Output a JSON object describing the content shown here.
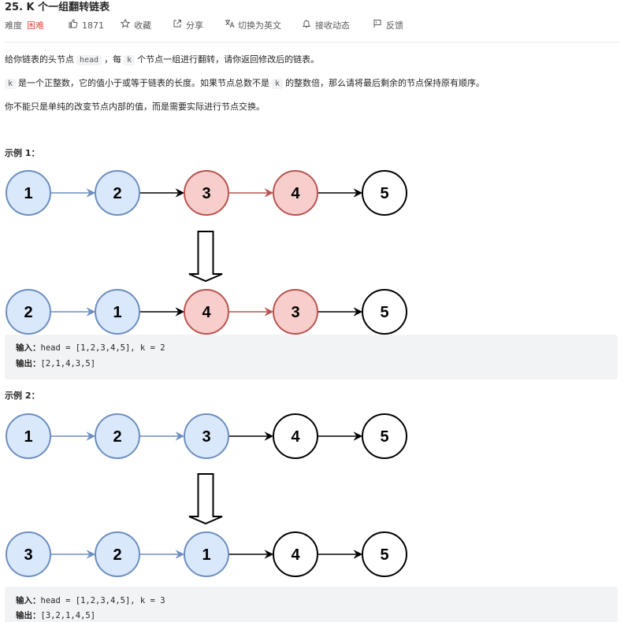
{
  "problem": {
    "title": "25. K 个一组翻转链表"
  },
  "meta": {
    "difficulty_label": "难度",
    "difficulty_value": "困难",
    "likes": "1871",
    "favorite_label": "收藏",
    "share_label": "分享",
    "switch_lang_label": "切换为英文",
    "notify_label": "接收动态",
    "feedback_label": "反馈",
    "icons": [
      "thumbs-up-icon",
      "star-icon",
      "share-icon",
      "translate-icon",
      "bell-icon",
      "feedback-icon"
    ],
    "hard_color": "#ef4743"
  },
  "description": {
    "p1_a": "给你链表的头节点",
    "p1_code": "head",
    "p1_b": "，每",
    "p1_k": "k",
    "p1_c": "个节点一组进行翻转，请你返回修改后的链表。",
    "p2_k": "k",
    "p2_a": "是一个正整数，它的值小于或等于链表的长度。如果节点总数不是",
    "p2_k2": "k",
    "p2_b": "的整数倍，那么请将最后剩余的节点保持原有顺序。",
    "p3": "你不能只是单纯的改变节点内部的值，而是需要实际进行节点交换。"
  },
  "examples": [
    {
      "title": "示例 1：",
      "before": [
        "1",
        "2",
        "3",
        "4",
        "5"
      ],
      "after": [
        "2",
        "1",
        "4",
        "3",
        "5"
      ],
      "before_groups": [
        "blue",
        "blue",
        "red",
        "red",
        "plain"
      ],
      "after_groups": [
        "blue",
        "blue",
        "red",
        "red",
        "plain"
      ],
      "input_label": "输入：",
      "input_value": "head = [1,2,3,4,5], k = 2",
      "output_label": "输出：",
      "output_value": "[2,1,4,3,5]"
    },
    {
      "title": "示例 2：",
      "before": [
        "1",
        "2",
        "3",
        "4",
        "5"
      ],
      "after": [
        "3",
        "2",
        "1",
        "4",
        "5"
      ],
      "before_groups": [
        "blue",
        "blue",
        "blue",
        "plain",
        "plain"
      ],
      "after_groups": [
        "blue",
        "blue",
        "blue",
        "plain",
        "plain"
      ],
      "input_label": "输入：",
      "input_value": "head = [1,2,3,4,5], k = 3",
      "output_label": "输出：",
      "output_value": "[3,2,1,4,5]"
    }
  ],
  "colors": {
    "blue_fill": "#dae8fc",
    "blue_stroke": "#6c8ebf",
    "red_fill": "#f8cecc",
    "red_stroke": "#b85450",
    "plain_fill": "#ffffff",
    "plain_stroke": "#000000"
  }
}
